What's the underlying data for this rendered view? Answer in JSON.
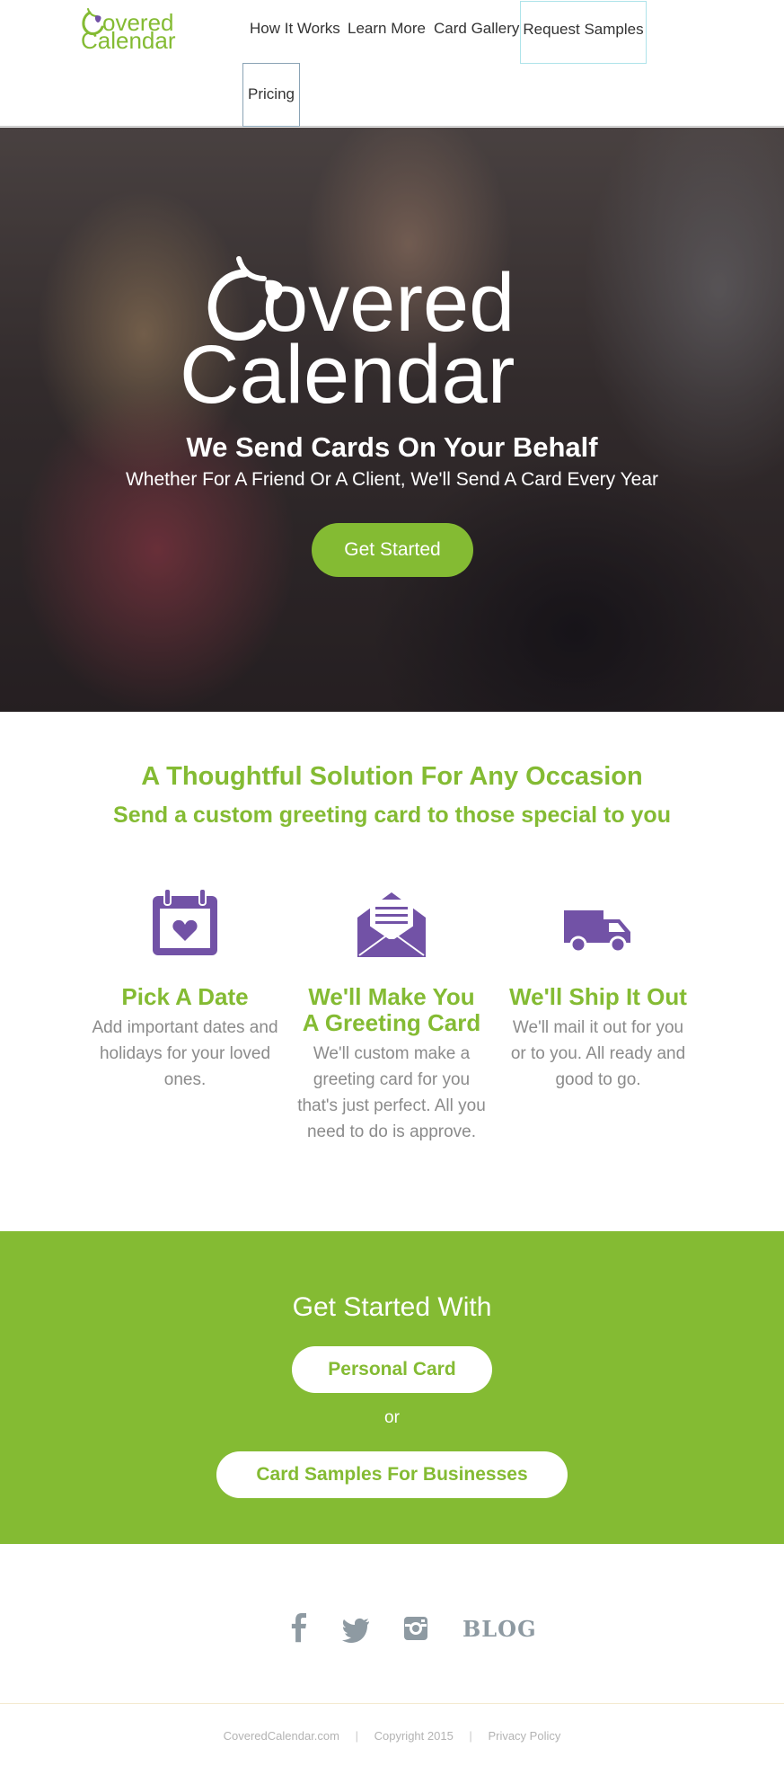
{
  "header": {
    "logo_text_top": "overed",
    "logo_text_bottom": "Calendar",
    "nav": [
      {
        "label": "How It Works"
      },
      {
        "label": "Learn More"
      },
      {
        "label": "Card Gallery"
      },
      {
        "label": "Request Samples"
      },
      {
        "label": "Pricing"
      }
    ]
  },
  "hero": {
    "logo_text_top": "overed",
    "logo_text_bottom": "Calendar",
    "headline": "We Send Cards On Your Behalf",
    "subheadline": "Whether For A Friend Or A Client, We'll Send A Card Every Year",
    "cta_label": "Get Started"
  },
  "occasion": {
    "title": "A Thoughtful Solution For Any Occasion",
    "subtitle": "Send a custom greeting card to those special to you",
    "features": [
      {
        "icon": "calendar-heart-icon",
        "title": "Pick A Date",
        "text": "Add important dates and holidays for your loved ones."
      },
      {
        "icon": "envelope-letter-icon",
        "title": "We'll Make You A Greeting Card",
        "text": "We'll custom make a greeting card for you that's just perfect. All you need to do is approve."
      },
      {
        "icon": "delivery-truck-icon",
        "title": "We'll Ship It Out",
        "text": "We'll mail it out for you or to you. All ready and good to go."
      }
    ]
  },
  "get_started": {
    "title": "Get Started With",
    "personal_label": "Personal Card",
    "or_label": "or",
    "business_label": "Card Samples For Businesses"
  },
  "social": {
    "icons": [
      "facebook-icon",
      "twitter-icon",
      "instagram-icon"
    ],
    "blog_label": "BLOG"
  },
  "footer": {
    "site": "CoveredCalendar.com",
    "copyright": "Copyright 2015",
    "privacy": "Privacy Policy"
  },
  "colors": {
    "brand_green": "#84bb33",
    "brand_purple": "#7252a6",
    "social_gray": "#8e9aa2"
  }
}
